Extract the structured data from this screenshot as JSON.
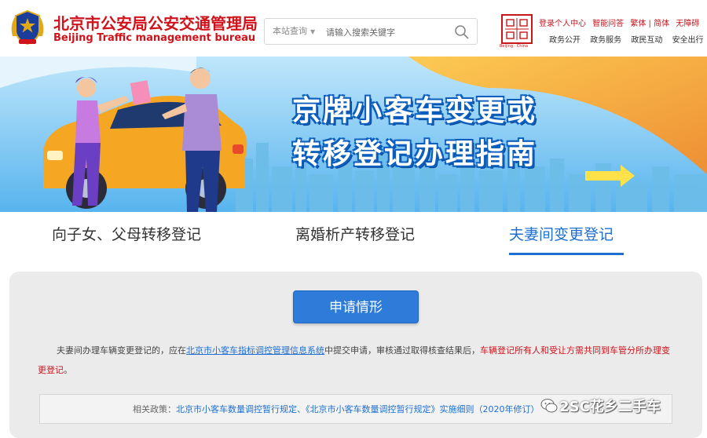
{
  "header": {
    "site_name": "北京市公安局公安交通管理局",
    "site_name_en": "Beijing Traffic management bureau",
    "search": {
      "scope_label": "本站查询",
      "placeholder": "请输入搜索关键字"
    },
    "seal_caption": "Beijing · China",
    "top_links": [
      "登录个人中心",
      "智能问答",
      "繁体 | 简体",
      "无障碍"
    ],
    "main_nav": [
      "政务公开",
      "政务服务",
      "政民互动",
      "安全出行"
    ]
  },
  "banner": {
    "title_line1": "京牌小客车变更或",
    "title_line2": "转移登记办理指南"
  },
  "tabs": [
    {
      "label": "向子女、父母转移登记",
      "active": false
    },
    {
      "label": "离婚析产转移登记",
      "active": false
    },
    {
      "label": "夫妻间变更登记",
      "active": true
    }
  ],
  "content": {
    "section_title": "申请情形",
    "para_part1": "夫妻间办理车辆变更登记的，应在",
    "para_link": "北京市小客车指标调控管理信息系统",
    "para_part2": "中提交申请，审核通过取得核查结果后，",
    "para_red": "车辆登记所有人和受让方需共同到车管分所办理变更登记",
    "para_end": "。",
    "policy_label": "相关政策：",
    "policy_links": "北京市小客车数量调控暂行规定、《北京市小客车数量调控暂行规定》实施细则（2020年修订）"
  },
  "watermark": "2SC花乡二手车",
  "colors": {
    "brand_red": "#d0121b",
    "accent_blue": "#1f6fd0",
    "banner_sky": "#5ab6f0"
  }
}
